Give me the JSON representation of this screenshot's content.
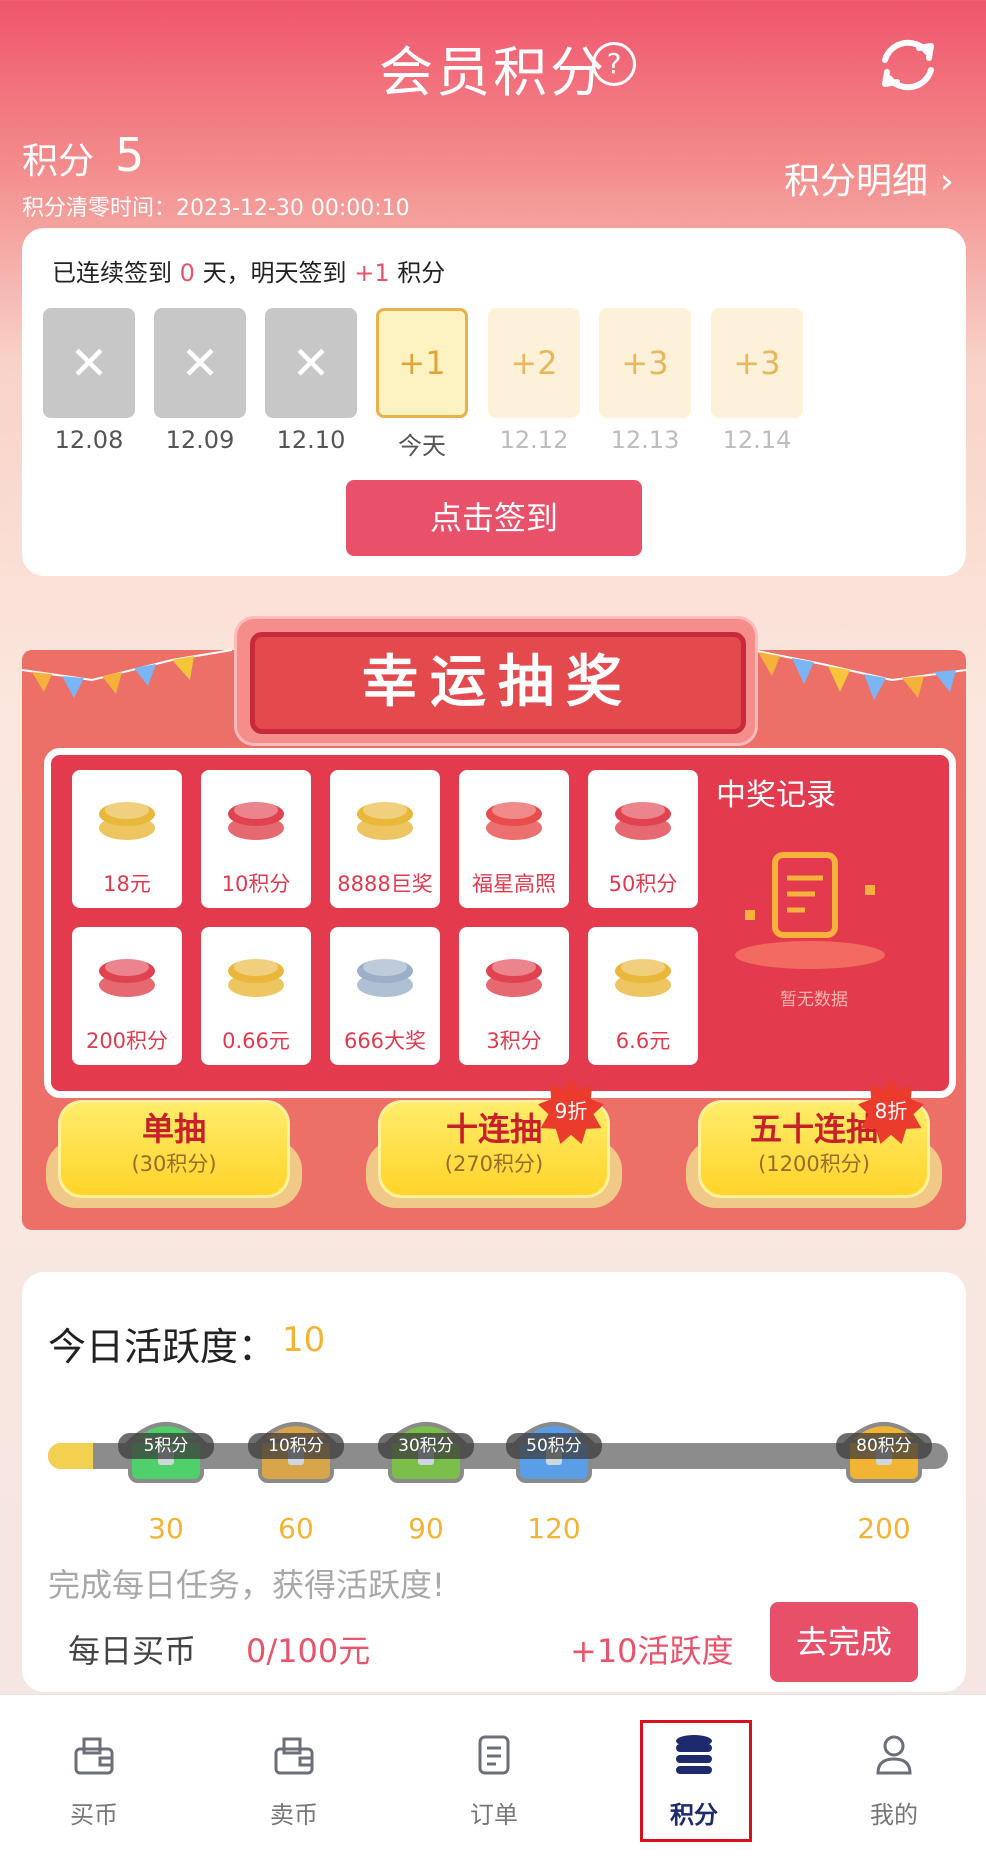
{
  "header": {
    "title": "会员积分",
    "help_icon": "?"
  },
  "points": {
    "label": "积分",
    "value": "5",
    "expire": "积分清零时间：2023-12-30 00:00:10",
    "detail_link": "积分明细 ›"
  },
  "checkin": {
    "streak_prefix": "已连续签到",
    "streak_days": "0",
    "streak_mid": "天，明天签到",
    "tomorrow_bonus": "+1",
    "streak_suffix": "积分",
    "days": [
      {
        "mark": "✕",
        "date": "12.08",
        "state": "missed"
      },
      {
        "mark": "✕",
        "date": "12.09",
        "state": "missed"
      },
      {
        "mark": "✕",
        "date": "12.10",
        "state": "missed"
      },
      {
        "mark": "+1",
        "date": "今天",
        "state": "today"
      },
      {
        "mark": "+2",
        "date": "12.12",
        "state": "future"
      },
      {
        "mark": "+3",
        "date": "12.13",
        "state": "future"
      },
      {
        "mark": "+3",
        "date": "12.14",
        "state": "future"
      }
    ],
    "button": "点击签到"
  },
  "lottery": {
    "title": "幸运抽奖",
    "prizes": [
      "18元",
      "10积分",
      "8888巨奖",
      "福星高照",
      "50积分",
      "200积分",
      "0.66元",
      "666大奖",
      "3积分",
      "6.6元"
    ],
    "record_title": "中奖记录",
    "record_empty": "暂无数据",
    "draws": [
      {
        "name": "单抽",
        "cost": "(30积分)",
        "discount": ""
      },
      {
        "name": "十连抽",
        "cost": "(270积分)",
        "discount": "9折"
      },
      {
        "name": "五十连抽",
        "cost": "(1200积分)",
        "discount": "8折"
      }
    ]
  },
  "activity": {
    "label": "今日活跃度：",
    "value": "10",
    "progress_fraction": 0.05,
    "chests": [
      {
        "reward": "5积分",
        "threshold": "30",
        "color": "#4fd06a"
      },
      {
        "reward": "10积分",
        "threshold": "60",
        "color": "#d9a54a"
      },
      {
        "reward": "30积分",
        "threshold": "90",
        "color": "#7bbf4a"
      },
      {
        "reward": "50积分",
        "threshold": "120",
        "color": "#5a9ee8"
      },
      {
        "reward": "80积分",
        "threshold": "200",
        "color": "#f2b434"
      }
    ],
    "task_tip": "完成每日任务，获得活跃度!",
    "task": {
      "name": "每日买币",
      "progress": "0/100元",
      "reward": "+10活跃度",
      "button": "去完成"
    }
  },
  "tabbar": [
    {
      "label": "买币",
      "icon": "wallet-icon",
      "active": false
    },
    {
      "label": "卖币",
      "icon": "wallet-icon",
      "active": false
    },
    {
      "label": "订单",
      "icon": "order-icon",
      "active": false
    },
    {
      "label": "积分",
      "icon": "coin-stack-icon",
      "active": true
    },
    {
      "label": "我的",
      "icon": "user-icon",
      "active": false
    }
  ],
  "colors": {
    "accent": "#e9506a",
    "gold": "#f2b434",
    "active_tab": "#1d2a6b"
  }
}
